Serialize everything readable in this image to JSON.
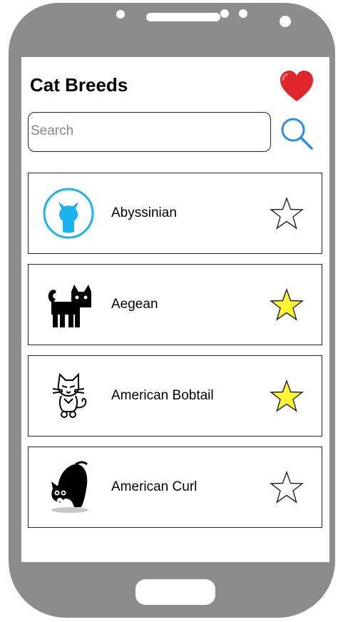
{
  "header": {
    "title": "Cat Breeds",
    "favorites_icon": "heart-icon"
  },
  "search": {
    "placeholder": "Search",
    "value": "",
    "icon": "search-icon"
  },
  "breeds": [
    {
      "name": "Abyssinian",
      "favorite": false
    },
    {
      "name": "Aegean",
      "favorite": true
    },
    {
      "name": "American Bobtail",
      "favorite": true
    },
    {
      "name": "American Curl",
      "favorite": false
    }
  ],
  "colors": {
    "frame": "#8c8c8c",
    "heart": "#e0262b",
    "star_on": "#fff532",
    "accent": "#2a8ee8",
    "github_blue": "#1cb4f0"
  }
}
